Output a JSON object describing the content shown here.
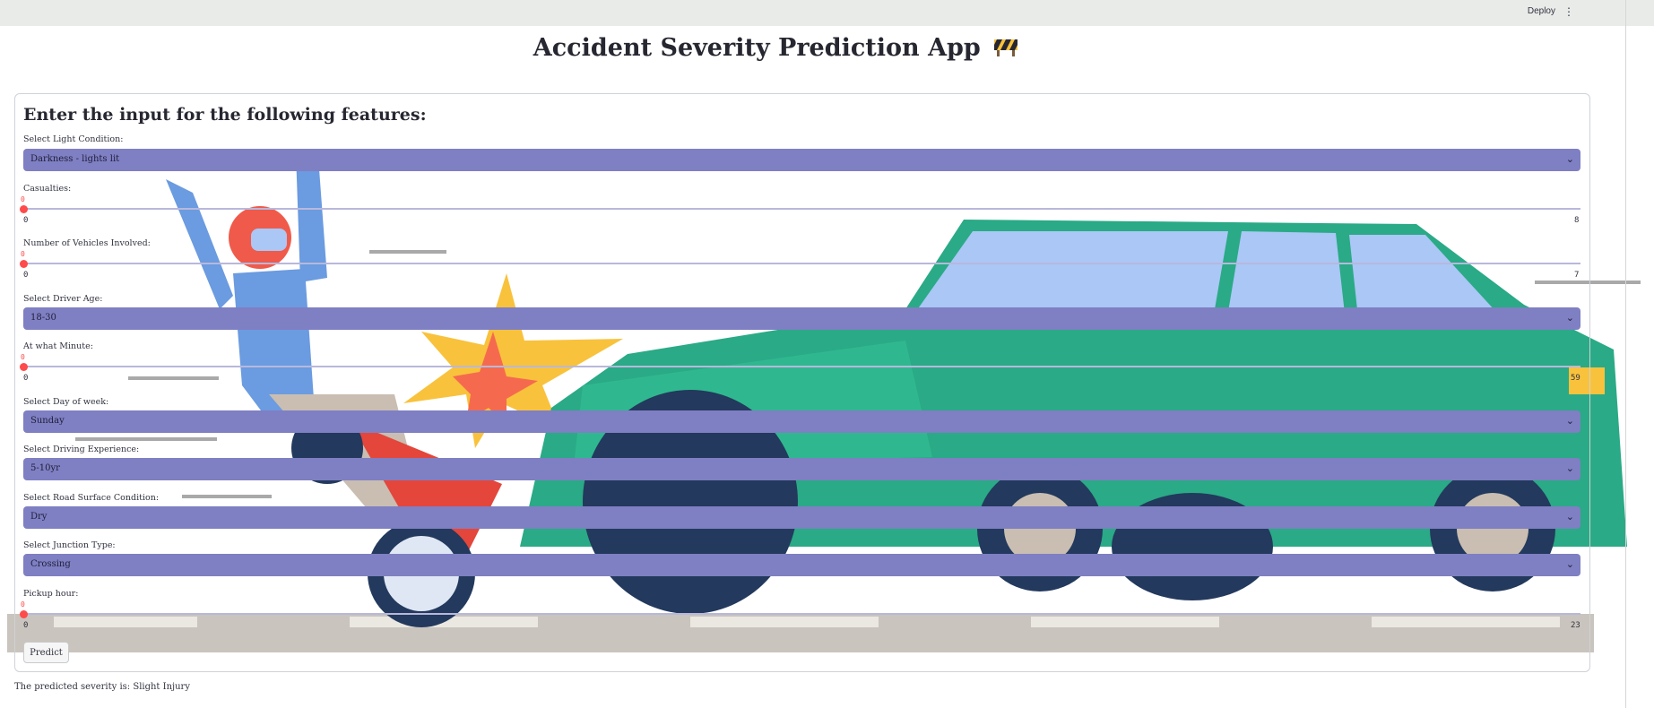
{
  "header": {
    "deploy_label": "Deploy",
    "menu_icon": "kebab-menu-icon"
  },
  "page": {
    "title": "Accident Severity Prediction App",
    "title_emoji": "construction-barrier-icon"
  },
  "form": {
    "heading": "Enter the input for the following features:",
    "fields": [
      {
        "kind": "select",
        "label": "Select Light Condition:",
        "value": "Darkness - lights lit"
      },
      {
        "kind": "slider",
        "label": "Casualties:",
        "value": "0",
        "min": "0",
        "max": "8"
      },
      {
        "kind": "slider",
        "label": "Number of Vehicles Involved:",
        "value": "0",
        "min": "0",
        "max": "7"
      },
      {
        "kind": "select",
        "label": "Select Driver Age:",
        "value": "18-30"
      },
      {
        "kind": "slider",
        "label": "At what Minute:",
        "value": "0",
        "min": "0",
        "max": "59"
      },
      {
        "kind": "select",
        "label": "Select Day of week:",
        "value": "Sunday"
      },
      {
        "kind": "select",
        "label": "Select Driving Experience:",
        "value": "5-10yr"
      },
      {
        "kind": "select",
        "label": "Select Road Surface Condition:",
        "value": "Dry"
      },
      {
        "kind": "select",
        "label": "Select Junction Type:",
        "value": "Crossing"
      },
      {
        "kind": "slider",
        "label": "Pickup hour:",
        "value": "0",
        "min": "0",
        "max": "23"
      }
    ],
    "predict_label": "Predict"
  },
  "result": {
    "text": "The predicted severity is: Slight Injury"
  },
  "colors": {
    "select_bg": "#7f7fc3",
    "slider_accent": "#ff4b4b",
    "car": "#2aaa86",
    "header_bg": "#e9ebe9"
  }
}
